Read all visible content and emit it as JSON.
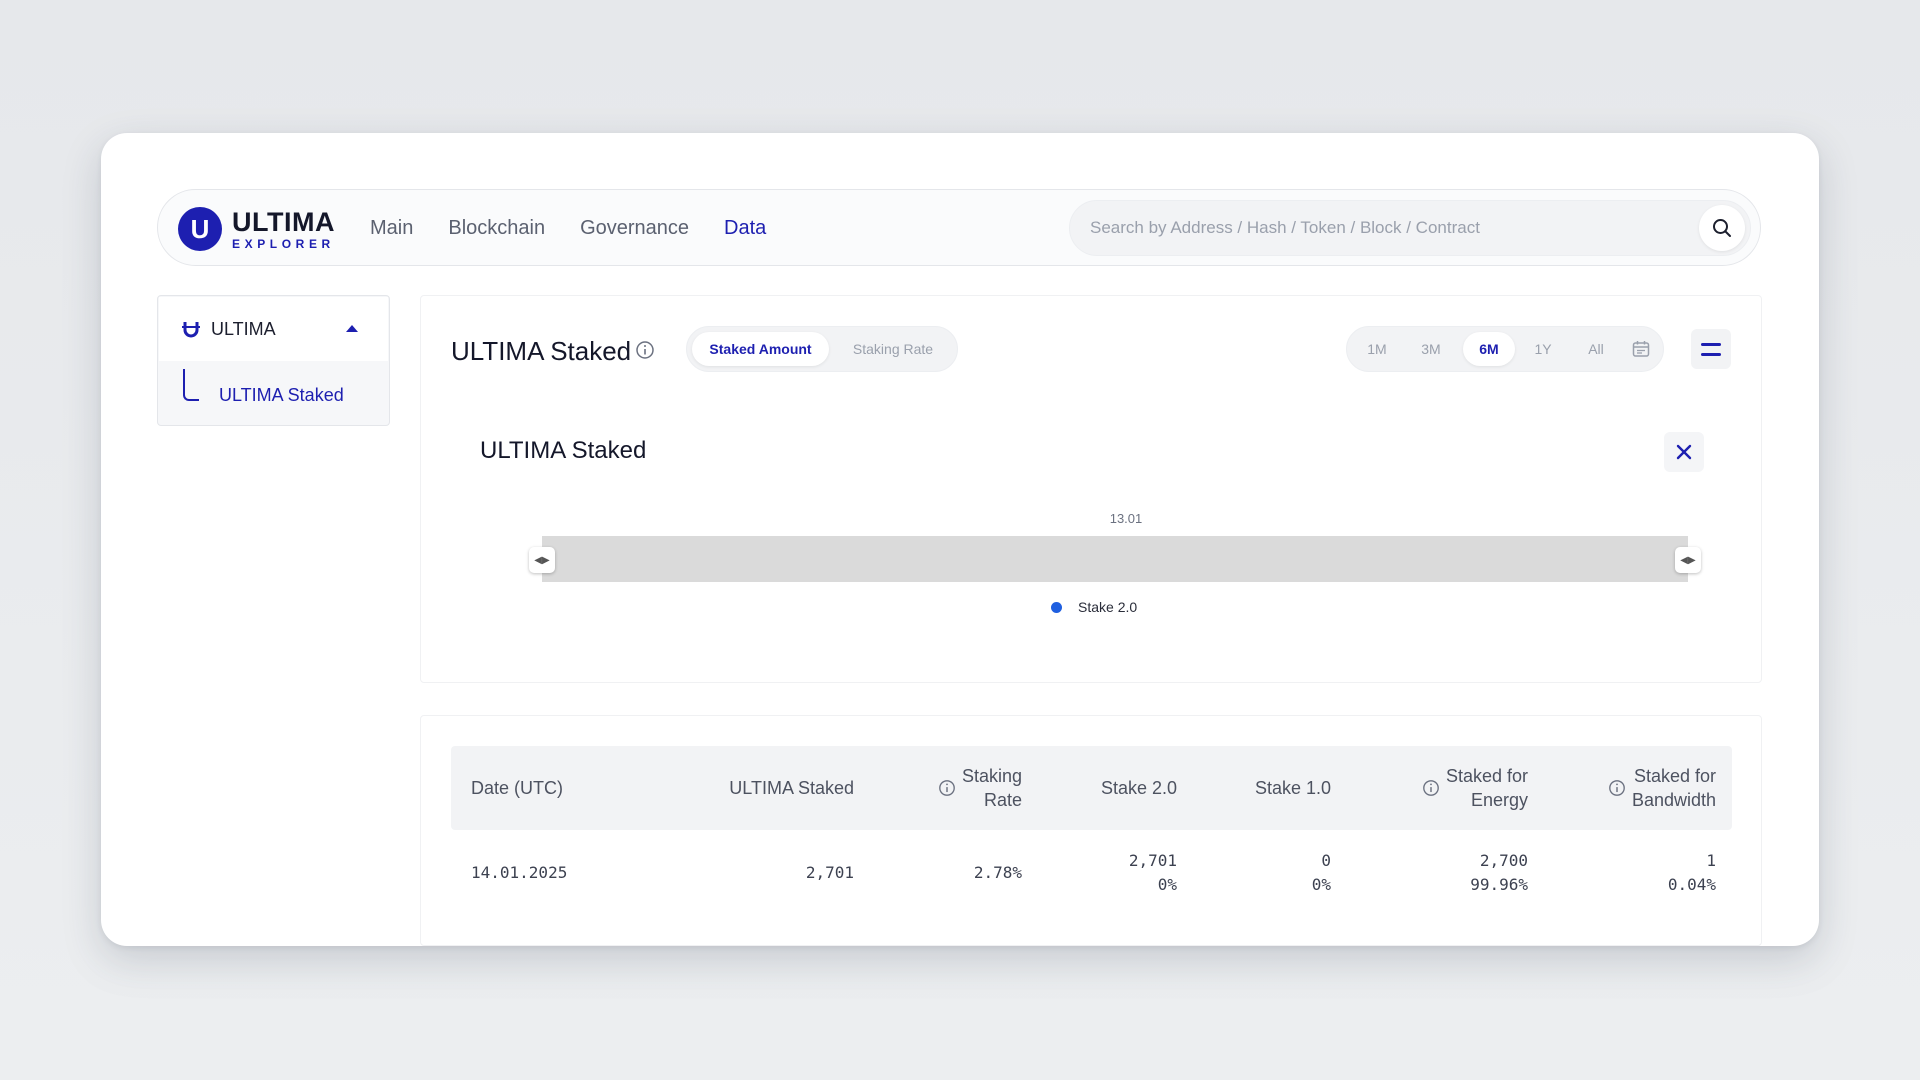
{
  "brand": {
    "title": "ULTIMA",
    "subtitle": "EXPLORER",
    "mark": "U"
  },
  "nav": [
    "Main",
    "Blockchain",
    "Governance",
    "Data"
  ],
  "search": {
    "placeholder": "Search by Address / Hash / Token / Block / Contract"
  },
  "sidebar": {
    "group": "ULTIMA",
    "child": "ULTIMA Staked"
  },
  "panel": {
    "title": "ULTIMA Staked",
    "tabs": {
      "active": "Staked Amount",
      "inactive": "Staking Rate"
    },
    "ranges": [
      "1M",
      "3M",
      "6M",
      "1Y",
      "All"
    ],
    "active_range": "6M"
  },
  "chart": {
    "title": "ULTIMA Staked",
    "zoom_label": "13.01",
    "legend": "Stake 2.0",
    "series_color": "#1f5fe0"
  },
  "table": {
    "headers": [
      "Date (UTC)",
      "ULTIMA Staked",
      "Staking Rate",
      "Stake 2.0",
      "Stake 1.0",
      "Staked for Energy",
      "Staked for Bandwidth"
    ],
    "header_lines": {
      "staking_rate": [
        "Staking",
        "Rate"
      ],
      "energy": [
        "Staked for",
        "Energy"
      ],
      "bandwidth": [
        "Staked for",
        "Bandwidth"
      ]
    },
    "rows": [
      {
        "date": "14.01.2025",
        "staked": "2,701",
        "rate": "2.78%",
        "stake2": "2,701",
        "stake2_pct": "0%",
        "stake1": "0",
        "stake1_pct": "0%",
        "energy": "2,700",
        "energy_pct": "99.96%",
        "bandwidth": "1",
        "bandwidth_pct": "0.04%"
      }
    ]
  },
  "colors": {
    "accent": "#1d1fb0",
    "background": "#e6e8eb"
  }
}
